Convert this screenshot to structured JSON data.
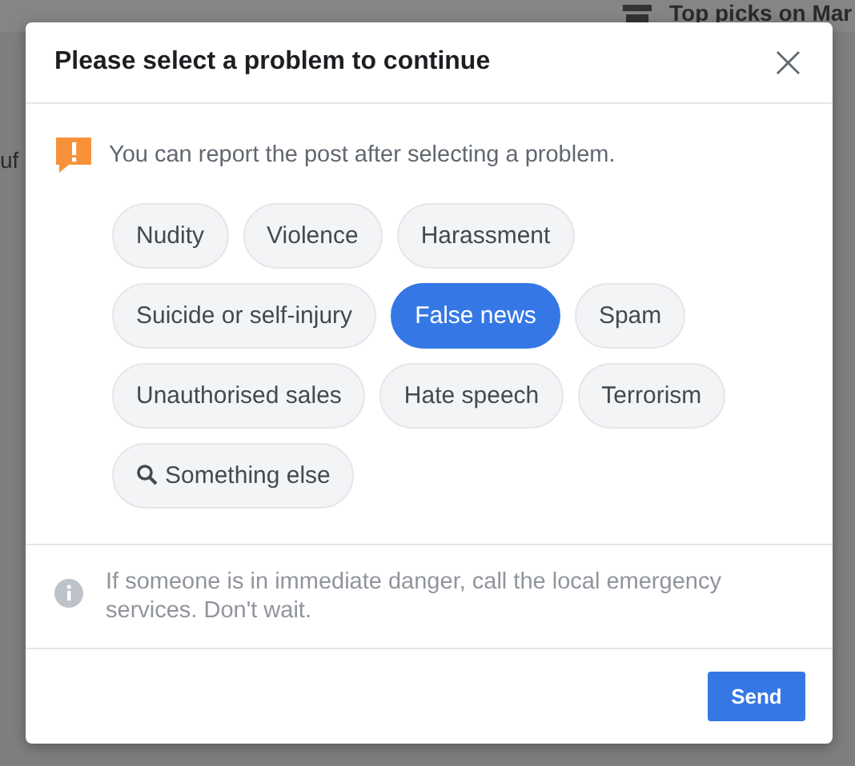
{
  "background": {
    "heading": "Top picks on Mar",
    "fragment": "uf"
  },
  "dialog": {
    "title": "Please select a problem to continue",
    "close": "×",
    "notice": "You can report the post after selecting a problem.",
    "problems": [
      {
        "label": "Nudity",
        "selected": false
      },
      {
        "label": "Violence",
        "selected": false
      },
      {
        "label": "Harassment",
        "selected": false
      },
      {
        "label": "Suicide or self-injury",
        "selected": false
      },
      {
        "label": "False news",
        "selected": true
      },
      {
        "label": "Spam",
        "selected": false
      },
      {
        "label": "Unauthorised sales",
        "selected": false
      },
      {
        "label": "Hate speech",
        "selected": false
      },
      {
        "label": "Terrorism",
        "selected": false
      },
      {
        "label": "Something else",
        "selected": false,
        "kind": "search"
      }
    ],
    "info": "If someone is in immediate danger, call the local emergency services. Don't wait.",
    "button": "Send"
  }
}
